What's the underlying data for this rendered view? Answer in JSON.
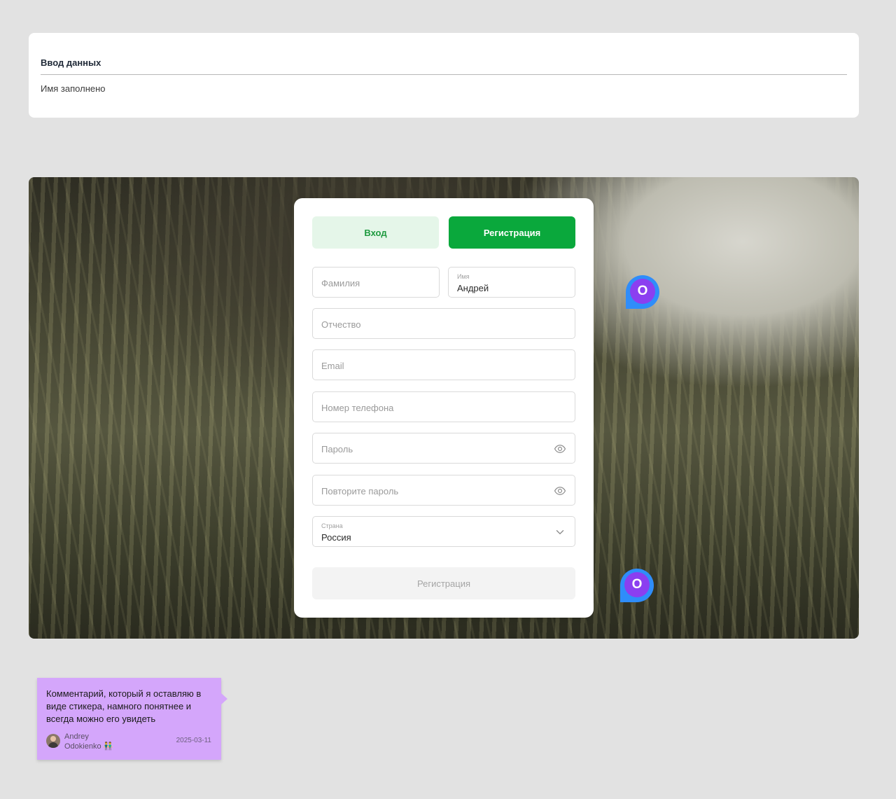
{
  "data_card": {
    "title": "Ввод данных",
    "status": "Имя заполнено"
  },
  "tabs": {
    "login": "Вход",
    "register": "Регистрация"
  },
  "form": {
    "last_name": {
      "placeholder": "Фамилия"
    },
    "first_name": {
      "label": "Имя",
      "value": "Андрей"
    },
    "patronymic": {
      "placeholder": "Отчество"
    },
    "email": {
      "placeholder": "Email"
    },
    "phone": {
      "placeholder": "Номер телефона"
    },
    "password": {
      "placeholder": "Пароль",
      "icon": "eye-icon"
    },
    "password_repeat": {
      "placeholder": "Повторите пароль",
      "icon": "eye-icon"
    },
    "country": {
      "label": "Страна",
      "value": "Россия",
      "icon": "chevron-down-icon"
    },
    "submit_label": "Регистрация"
  },
  "markers": [
    {
      "letter": "O"
    },
    {
      "letter": "O"
    }
  ],
  "sticker": {
    "text": "Комментарий, который я оставляю в виде стикера, намного понятнее и всегда можно его увидеть",
    "author_first": "Andrey",
    "author_last": "Odokienko",
    "author_emoji": "👬",
    "date": "2025-03-11"
  },
  "colors": {
    "primary_green": "#0aa83c",
    "light_green": "#e5f6e9",
    "marker_blue": "#2f8dfa",
    "marker_purple": "#8b3ff0",
    "sticker_purple": "#d4a6fb"
  }
}
